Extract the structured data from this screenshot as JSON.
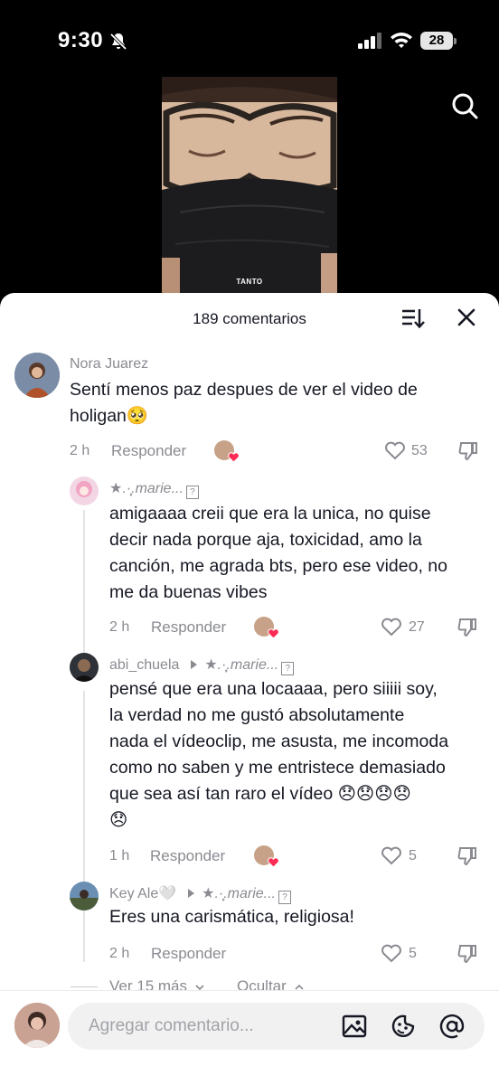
{
  "status": {
    "time": "9:30",
    "battery": "28"
  },
  "video": {
    "caption": "TANTO"
  },
  "sheet": {
    "count_label": "189 comentarios"
  },
  "comments": [
    {
      "user": "Nora Juarez",
      "text_lines": [
        "Sentí menos paz despues de ver el video de",
        "holigan🥺"
      ],
      "time": "2 h",
      "reply_label": "Responder",
      "likes": "53"
    },
    {
      "user": "★.·̩͙.marie...",
      "text_lines": [
        "amigaaaa creii que era la unica, no quise",
        "decir nada porque aja, toxicidad, amo la",
        "canción, me agrada bts, pero ese video, no",
        "me da buenas vibes"
      ],
      "time": "2 h",
      "reply_label": "Responder",
      "likes": "27"
    },
    {
      "user": "abi_chuela",
      "reply_to": "★.·̩͙.marie...",
      "text_lines": [
        "pensé que era una locaaaa, pero siiiii soy,",
        "la verdad no me gustó absolutamente",
        "nada el vídeoclip, me asusta, me incomoda",
        "como no saben y me entristece demasiado",
        "que sea así tan raro el vídeo 😞😞😞😞",
        "😞"
      ],
      "time": "1 h",
      "reply_label": "Responder",
      "likes": "5"
    },
    {
      "user": "Key Ale🤍",
      "reply_to": "★.·̩͙.marie...",
      "text_lines": [
        "Eres una carismática, religiosa!"
      ],
      "time": "2 h",
      "reply_label": "Responder",
      "likes": "5"
    }
  ],
  "thread_controls": {
    "more_label": "Ver 15 más",
    "hide_label": "Ocultar"
  },
  "composer": {
    "placeholder": "Agregar comentario..."
  },
  "icons": [
    "bell-muted-icon",
    "signal-icon",
    "wifi-icon",
    "battery-icon",
    "search-icon",
    "sort-icon",
    "close-icon",
    "heart-icon",
    "dislike-icon",
    "image-icon",
    "emoji-icon",
    "mention-icon"
  ]
}
